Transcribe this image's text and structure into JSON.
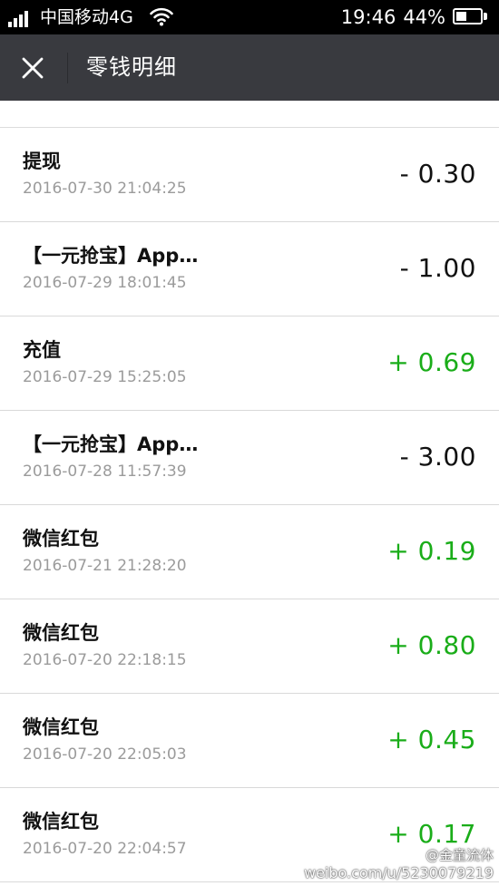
{
  "status_bar": {
    "carrier": "中国移动4G",
    "time": "19:46",
    "battery_percent": "44%",
    "battery_level": 0.44,
    "icons": [
      "signal-icon",
      "wifi-icon",
      "battery-icon"
    ]
  },
  "nav": {
    "close_icon": "close-icon",
    "title": "零钱明细"
  },
  "transactions": [
    {
      "title": "提现",
      "time": "2016-07-30 21:04:25",
      "amount": "- 0.30",
      "direction": "out"
    },
    {
      "title": "【一元抢宝】App…",
      "time": "2016-07-29 18:01:45",
      "amount": "- 1.00",
      "direction": "out"
    },
    {
      "title": "充值",
      "time": "2016-07-29 15:25:05",
      "amount": "+ 0.69",
      "direction": "in"
    },
    {
      "title": "【一元抢宝】App…",
      "time": "2016-07-28 11:57:39",
      "amount": "- 3.00",
      "direction": "out"
    },
    {
      "title": "微信红包",
      "time": "2016-07-21 21:28:20",
      "amount": "+ 0.19",
      "direction": "in"
    },
    {
      "title": "微信红包",
      "time": "2016-07-20 22:18:15",
      "amount": "+ 0.80",
      "direction": "in"
    },
    {
      "title": "微信红包",
      "time": "2016-07-20 22:05:03",
      "amount": "+ 0.45",
      "direction": "in"
    },
    {
      "title": "微信红包",
      "time": "2016-07-20 22:04:57",
      "amount": "+ 0.17",
      "direction": "in"
    }
  ],
  "colors": {
    "status_bar_bg": "#000000",
    "nav_bg": "#393a3f",
    "income_green": "#1aad19",
    "expense_black": "#111111",
    "time_gray": "#9b9b9b"
  },
  "watermark": {
    "user": "@金童流体",
    "url": "weibo.com/u/5230079219"
  }
}
